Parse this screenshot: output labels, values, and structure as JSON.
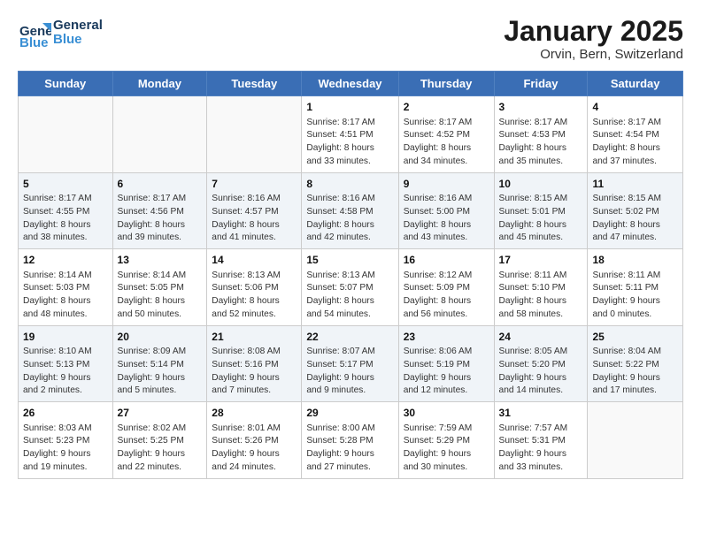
{
  "logo": {
    "line1": "General",
    "line2": "Blue"
  },
  "title": "January 2025",
  "subtitle": "Orvin, Bern, Switzerland",
  "weekdays": [
    "Sunday",
    "Monday",
    "Tuesday",
    "Wednesday",
    "Thursday",
    "Friday",
    "Saturday"
  ],
  "weeks": [
    [
      {
        "day": "",
        "info": ""
      },
      {
        "day": "",
        "info": ""
      },
      {
        "day": "",
        "info": ""
      },
      {
        "day": "1",
        "info": "Sunrise: 8:17 AM\nSunset: 4:51 PM\nDaylight: 8 hours\nand 33 minutes."
      },
      {
        "day": "2",
        "info": "Sunrise: 8:17 AM\nSunset: 4:52 PM\nDaylight: 8 hours\nand 34 minutes."
      },
      {
        "day": "3",
        "info": "Sunrise: 8:17 AM\nSunset: 4:53 PM\nDaylight: 8 hours\nand 35 minutes."
      },
      {
        "day": "4",
        "info": "Sunrise: 8:17 AM\nSunset: 4:54 PM\nDaylight: 8 hours\nand 37 minutes."
      }
    ],
    [
      {
        "day": "5",
        "info": "Sunrise: 8:17 AM\nSunset: 4:55 PM\nDaylight: 8 hours\nand 38 minutes."
      },
      {
        "day": "6",
        "info": "Sunrise: 8:17 AM\nSunset: 4:56 PM\nDaylight: 8 hours\nand 39 minutes."
      },
      {
        "day": "7",
        "info": "Sunrise: 8:16 AM\nSunset: 4:57 PM\nDaylight: 8 hours\nand 41 minutes."
      },
      {
        "day": "8",
        "info": "Sunrise: 8:16 AM\nSunset: 4:58 PM\nDaylight: 8 hours\nand 42 minutes."
      },
      {
        "day": "9",
        "info": "Sunrise: 8:16 AM\nSunset: 5:00 PM\nDaylight: 8 hours\nand 43 minutes."
      },
      {
        "day": "10",
        "info": "Sunrise: 8:15 AM\nSunset: 5:01 PM\nDaylight: 8 hours\nand 45 minutes."
      },
      {
        "day": "11",
        "info": "Sunrise: 8:15 AM\nSunset: 5:02 PM\nDaylight: 8 hours\nand 47 minutes."
      }
    ],
    [
      {
        "day": "12",
        "info": "Sunrise: 8:14 AM\nSunset: 5:03 PM\nDaylight: 8 hours\nand 48 minutes."
      },
      {
        "day": "13",
        "info": "Sunrise: 8:14 AM\nSunset: 5:05 PM\nDaylight: 8 hours\nand 50 minutes."
      },
      {
        "day": "14",
        "info": "Sunrise: 8:13 AM\nSunset: 5:06 PM\nDaylight: 8 hours\nand 52 minutes."
      },
      {
        "day": "15",
        "info": "Sunrise: 8:13 AM\nSunset: 5:07 PM\nDaylight: 8 hours\nand 54 minutes."
      },
      {
        "day": "16",
        "info": "Sunrise: 8:12 AM\nSunset: 5:09 PM\nDaylight: 8 hours\nand 56 minutes."
      },
      {
        "day": "17",
        "info": "Sunrise: 8:11 AM\nSunset: 5:10 PM\nDaylight: 8 hours\nand 58 minutes."
      },
      {
        "day": "18",
        "info": "Sunrise: 8:11 AM\nSunset: 5:11 PM\nDaylight: 9 hours\nand 0 minutes."
      }
    ],
    [
      {
        "day": "19",
        "info": "Sunrise: 8:10 AM\nSunset: 5:13 PM\nDaylight: 9 hours\nand 2 minutes."
      },
      {
        "day": "20",
        "info": "Sunrise: 8:09 AM\nSunset: 5:14 PM\nDaylight: 9 hours\nand 5 minutes."
      },
      {
        "day": "21",
        "info": "Sunrise: 8:08 AM\nSunset: 5:16 PM\nDaylight: 9 hours\nand 7 minutes."
      },
      {
        "day": "22",
        "info": "Sunrise: 8:07 AM\nSunset: 5:17 PM\nDaylight: 9 hours\nand 9 minutes."
      },
      {
        "day": "23",
        "info": "Sunrise: 8:06 AM\nSunset: 5:19 PM\nDaylight: 9 hours\nand 12 minutes."
      },
      {
        "day": "24",
        "info": "Sunrise: 8:05 AM\nSunset: 5:20 PM\nDaylight: 9 hours\nand 14 minutes."
      },
      {
        "day": "25",
        "info": "Sunrise: 8:04 AM\nSunset: 5:22 PM\nDaylight: 9 hours\nand 17 minutes."
      }
    ],
    [
      {
        "day": "26",
        "info": "Sunrise: 8:03 AM\nSunset: 5:23 PM\nDaylight: 9 hours\nand 19 minutes."
      },
      {
        "day": "27",
        "info": "Sunrise: 8:02 AM\nSunset: 5:25 PM\nDaylight: 9 hours\nand 22 minutes."
      },
      {
        "day": "28",
        "info": "Sunrise: 8:01 AM\nSunset: 5:26 PM\nDaylight: 9 hours\nand 24 minutes."
      },
      {
        "day": "29",
        "info": "Sunrise: 8:00 AM\nSunset: 5:28 PM\nDaylight: 9 hours\nand 27 minutes."
      },
      {
        "day": "30",
        "info": "Sunrise: 7:59 AM\nSunset: 5:29 PM\nDaylight: 9 hours\nand 30 minutes."
      },
      {
        "day": "31",
        "info": "Sunrise: 7:57 AM\nSunset: 5:31 PM\nDaylight: 9 hours\nand 33 minutes."
      },
      {
        "day": "",
        "info": ""
      }
    ]
  ]
}
